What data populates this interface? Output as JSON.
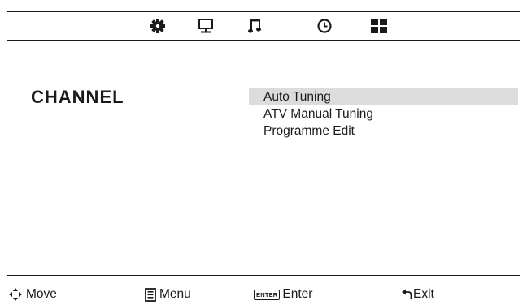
{
  "top_tabs": [
    {
      "icon": "picture-gear-icon",
      "label": ""
    },
    {
      "icon": "monitor-icon",
      "label": ""
    },
    {
      "icon": "music-note-icon",
      "label": ""
    },
    {
      "icon": "clock-icon",
      "label": ""
    },
    {
      "icon": "grid-icon",
      "label": ""
    }
  ],
  "section": {
    "title": "CHANNEL"
  },
  "menu": {
    "items": [
      {
        "label": "Auto Tuning",
        "selected": true
      },
      {
        "label": "ATV Manual Tuning",
        "selected": false
      },
      {
        "label": "Programme Edit",
        "selected": false
      }
    ]
  },
  "hints": {
    "move": {
      "icon": "four-way-arrow-icon",
      "label": "Move"
    },
    "menu": {
      "icon": "menu-icon",
      "label": "Menu"
    },
    "enter": {
      "key": "ENTER",
      "label": "Enter"
    },
    "exit": {
      "icon": "return-arrow-icon",
      "label": "Exit"
    }
  },
  "colors": {
    "foreground": "#1a1a1a",
    "selection": "#dcdcdc",
    "background": "#ffffff"
  }
}
